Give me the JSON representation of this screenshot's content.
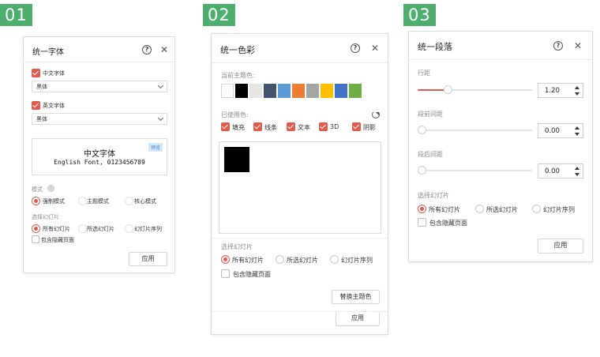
{
  "badges": [
    "01",
    "02",
    "03"
  ],
  "font_panel": {
    "title": "统一字体",
    "cn_font_label": "中文字体",
    "cn_font_value": "黑体",
    "en_font_label": "英文字体",
    "en_font_value": "黑体",
    "preview_tag": "预览",
    "preview_cn": "中文字体",
    "preview_en": "English Font, 0123456789",
    "mode_label": "模式",
    "modes": [
      "强制模式",
      "主题模式",
      "核心模式"
    ],
    "scope_label": "选择幻灯片",
    "scopes": [
      "所有幻灯片",
      "所选幻灯片",
      "幻灯片序列"
    ],
    "include_hidden": "包含隐藏页面",
    "apply": "应用"
  },
  "color_panel": {
    "title": "统一色彩",
    "current_theme_label": "当前主题色:",
    "swatches": [
      "#ffffff",
      "#000000",
      "#e7e6e6",
      "#44546a",
      "#5b9bd5",
      "#ed7d31",
      "#a5a5a5",
      "#ffc000",
      "#4472c4",
      "#70ad47"
    ],
    "used_colors_label": "已使用色:",
    "filters": [
      "填充",
      "线条",
      "文本",
      "3D",
      "阴影"
    ],
    "used_colors": [
      "#000000"
    ],
    "scope_label": "选择幻灯片",
    "scopes": [
      "所有幻灯片",
      "所选幻灯片",
      "幻灯片序列"
    ],
    "include_hidden": "包含隐藏页面",
    "replace_theme": "替换主题色",
    "apply": "应用"
  },
  "para_panel": {
    "title": "统一段落",
    "line_spacing_label": "行距",
    "line_spacing_value": "1.20",
    "before_label": "段前间距",
    "before_value": "0.00",
    "after_label": "段后间距",
    "after_value": "0.00",
    "scope_label": "选择幻灯片",
    "scopes": [
      "所有幻灯片",
      "所选幻灯片",
      "幻灯片序列"
    ],
    "include_hidden": "包含隐藏页面",
    "apply": "应用"
  },
  "colors": {
    "accent": "#e05a4e",
    "badge": "#4dae70"
  }
}
